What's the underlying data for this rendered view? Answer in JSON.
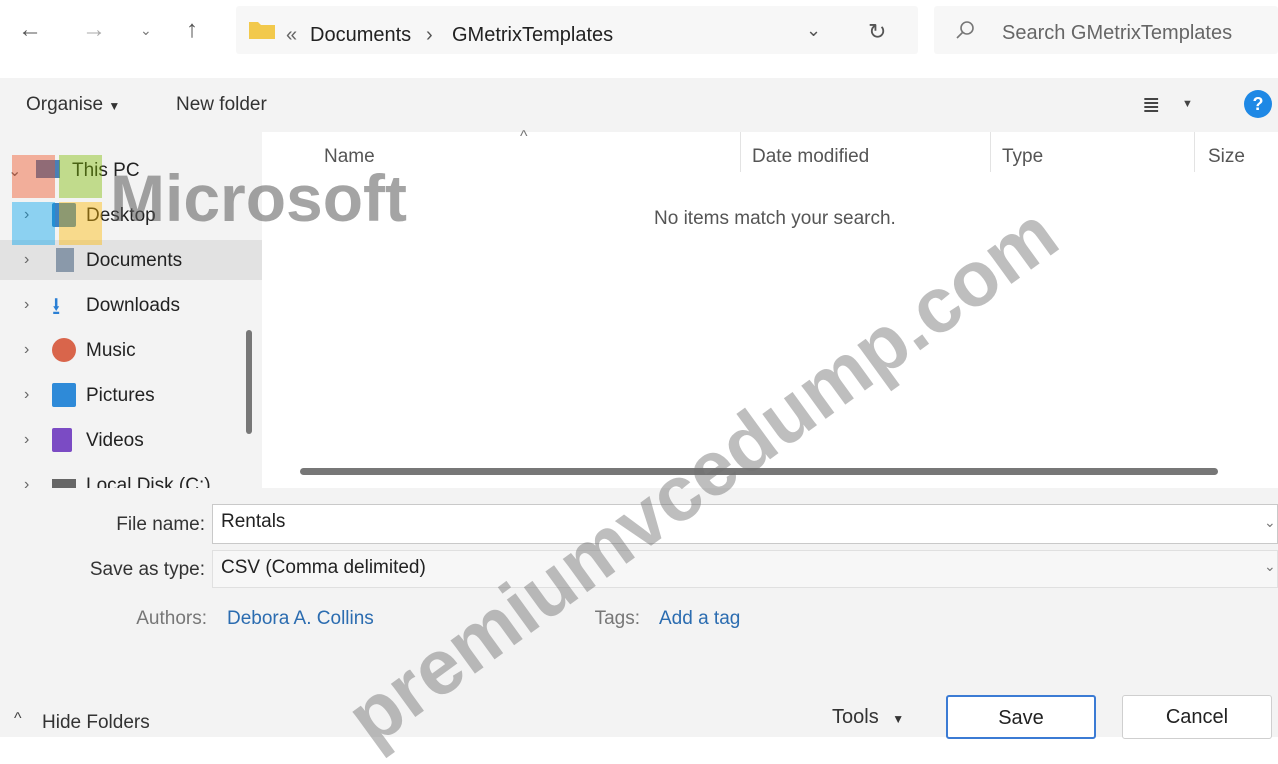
{
  "address_bar": {
    "breadcrumb_prefix": "«",
    "crumbs": [
      "Documents",
      "GMetrixTemplates"
    ],
    "separator": "›",
    "search_placeholder": "Search GMetrixTemplates"
  },
  "toolbar": {
    "organise_label": "Organise",
    "new_folder_label": "New folder"
  },
  "nav_pane": {
    "items": [
      {
        "label": "This PC",
        "icon": "pc-icon"
      },
      {
        "label": "Desktop",
        "icon": "desktop-folder-icon"
      },
      {
        "label": "Documents",
        "icon": "documents-icon",
        "selected": true
      },
      {
        "label": "Downloads",
        "icon": "download-icon"
      },
      {
        "label": "Music",
        "icon": "music-icon"
      },
      {
        "label": "Pictures",
        "icon": "pictures-icon"
      },
      {
        "label": "Videos",
        "icon": "videos-icon"
      },
      {
        "label": "Local Disk (C:)",
        "icon": "drive-icon"
      }
    ]
  },
  "file_list": {
    "columns": [
      "Name",
      "Date modified",
      "Type",
      "Size"
    ],
    "empty_message": "No items match your search."
  },
  "form": {
    "file_name_label": "File name:",
    "file_name_value": "Rentals",
    "save_type_label": "Save as type:",
    "save_type_value": "CSV (Comma delimited)",
    "authors_label": "Authors:",
    "authors_value": "Debora A. Collins",
    "tags_label": "Tags:",
    "tags_value": "Add a tag"
  },
  "footer": {
    "hide_folders_label": "Hide Folders",
    "tools_label": "Tools",
    "save_label": "Save",
    "cancel_label": "Cancel"
  },
  "watermarks": {
    "brand": "Microsoft",
    "site": "premiumvcedump.com"
  },
  "colors": {
    "folder": "#f2c94c",
    "link": "#2b6cb0",
    "help": "#1e88e5"
  }
}
